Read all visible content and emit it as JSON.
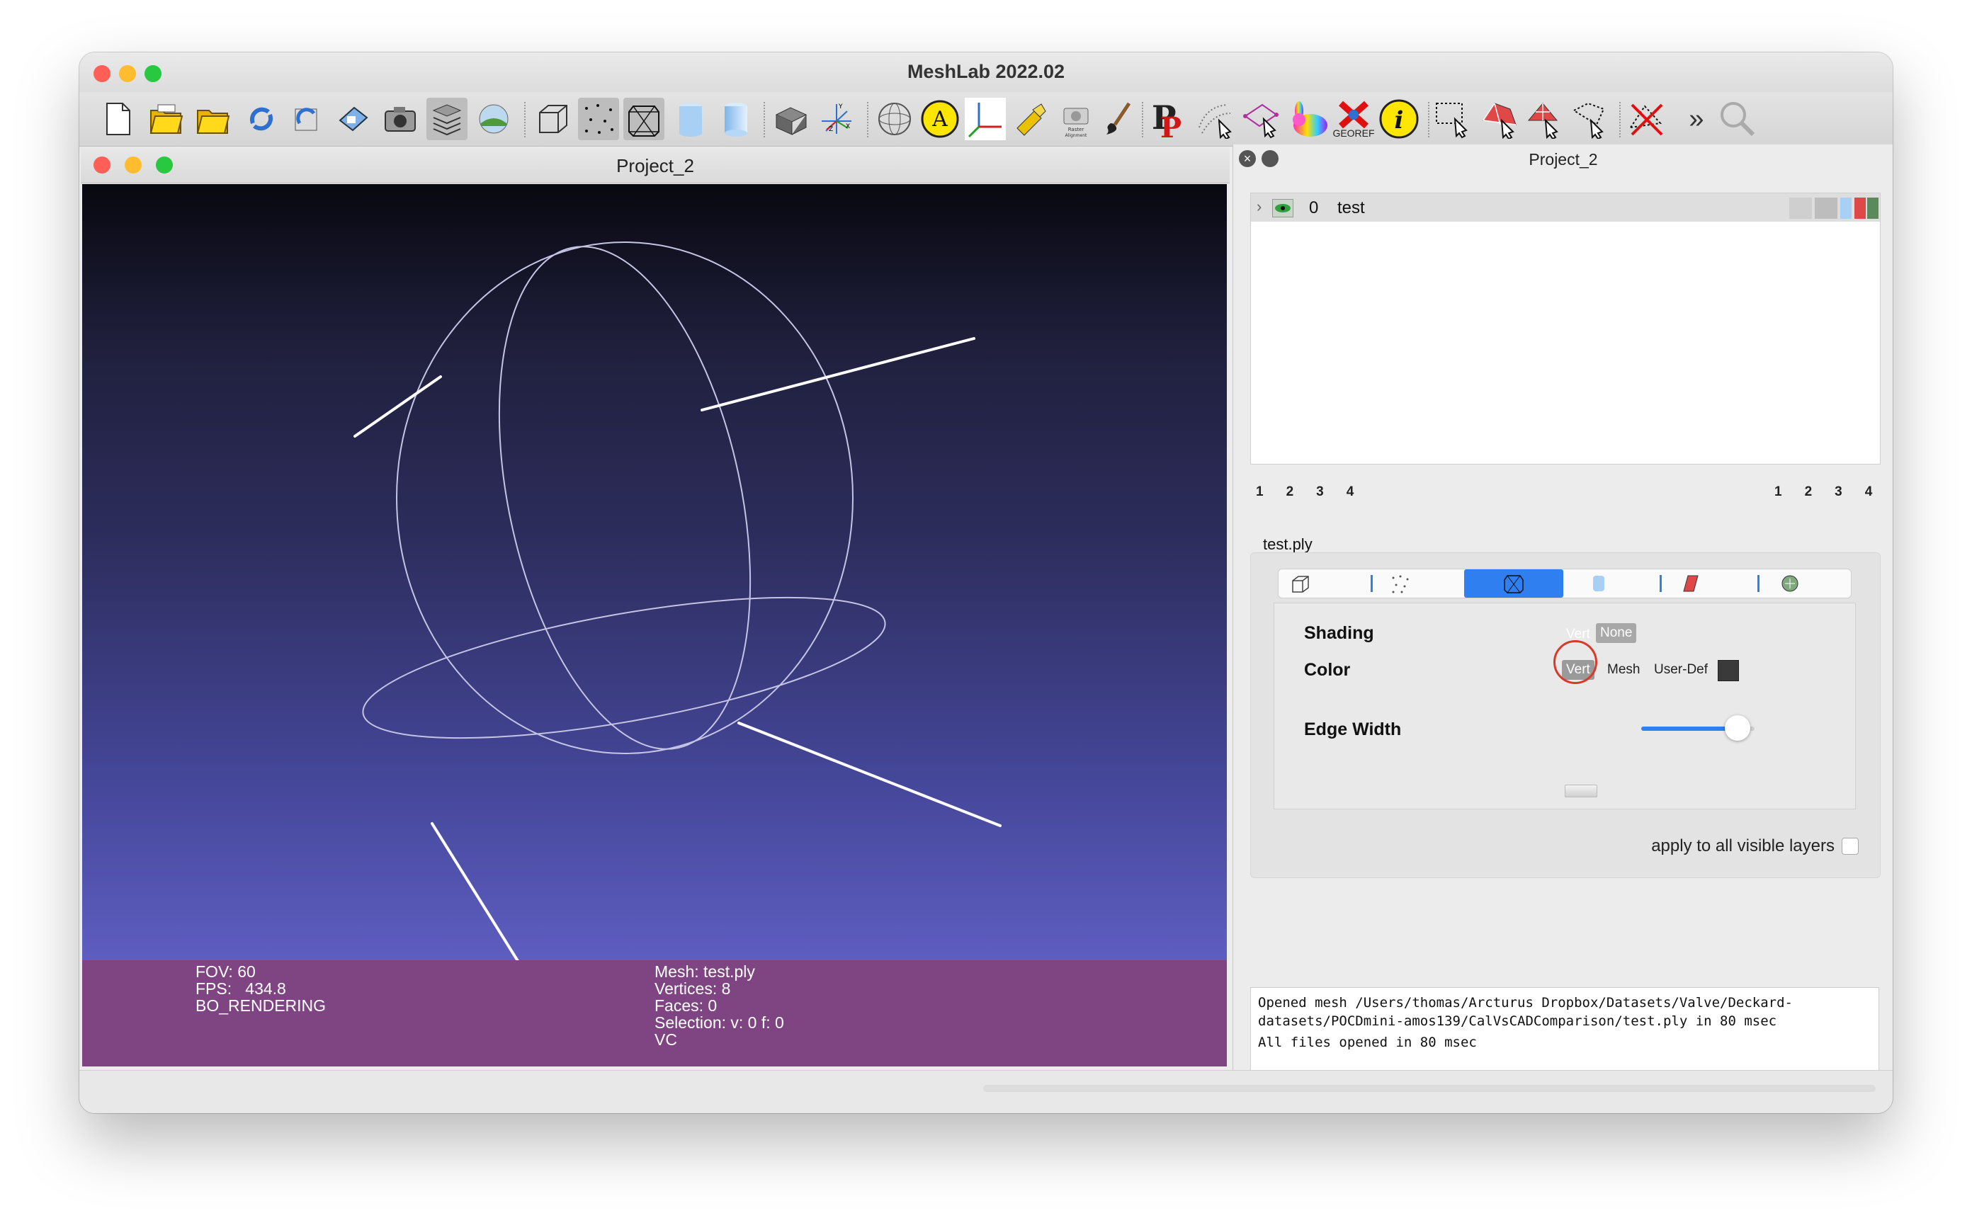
{
  "app": {
    "title": "MeshLab 2022.02"
  },
  "toolbar": {
    "items": [
      "new-document-icon",
      "open-project-icon",
      "open-mesh-icon",
      "import-mesh-icon",
      "reload-icon",
      "reload-all-icon",
      "save-icon",
      "snapshot-icon",
      "layers-icon",
      "raster-icon",
      "bounding-box-icon",
      "points-icon",
      "wireframe-icon",
      "flat-shading-icon",
      "smooth-shading-icon",
      "texture-icon",
      "trackball-icon",
      "axes-icon",
      "annotation-icon",
      "view-axis-icon",
      "align-icon",
      "raster-align-icon",
      "paint-icon",
      "pick-points-icon",
      "measure-icon",
      "select-vertex-icon",
      "rabbit-icon",
      "georef-icon",
      "info-icon",
      "select-rect-icon",
      "select-faces-icon",
      "select-connected-icon",
      "select-conn-icon",
      "delete-selection-icon",
      "more-icon",
      "search-icon"
    ],
    "georef_label": "GEOREF",
    "raster_label": "Raster Alignment",
    "letter_a": "A",
    "letter_i": "i",
    "more": "»"
  },
  "viewer": {
    "title": "Project_2",
    "info_left": {
      "fov": "FOV: 60",
      "fps": "FPS:   434.8",
      "mode": "BO_RENDERING"
    },
    "info_right": {
      "mesh": "Mesh: test.ply",
      "vertices": "Vertices: 8",
      "faces": "Faces: 0",
      "selection": "Selection: v: 0 f: 0",
      "vc": "VC"
    }
  },
  "panel": {
    "title": "Project_2",
    "layer": {
      "index": "0",
      "name": "test"
    },
    "pages_left": [
      "1",
      "2",
      "3",
      "4"
    ],
    "pages_right": [
      "1",
      "2",
      "3",
      "4"
    ],
    "file_label": "test.ply",
    "shading_label": "Shading",
    "shading_options": [
      "Vert",
      "None"
    ],
    "color_label": "Color",
    "color_options": [
      "Vert",
      "Mesh",
      "User-Def"
    ],
    "edge_width_label": "Edge Width",
    "edge_width_level": 0.85,
    "apply_all_label": "apply to all visible layers",
    "log": [
      "Opened mesh /Users/thomas/Arcturus Dropbox/Datasets/Valve/Deckard-",
      "datasets/POCDmini-amos139/CalVsCADComparison/test.ply in 80 msec",
      "All files opened in 80 msec"
    ]
  },
  "colors": {
    "accent": "#2f7ff0",
    "info_bar": "#7f4582",
    "highlight_circle": "#d83a2a"
  }
}
